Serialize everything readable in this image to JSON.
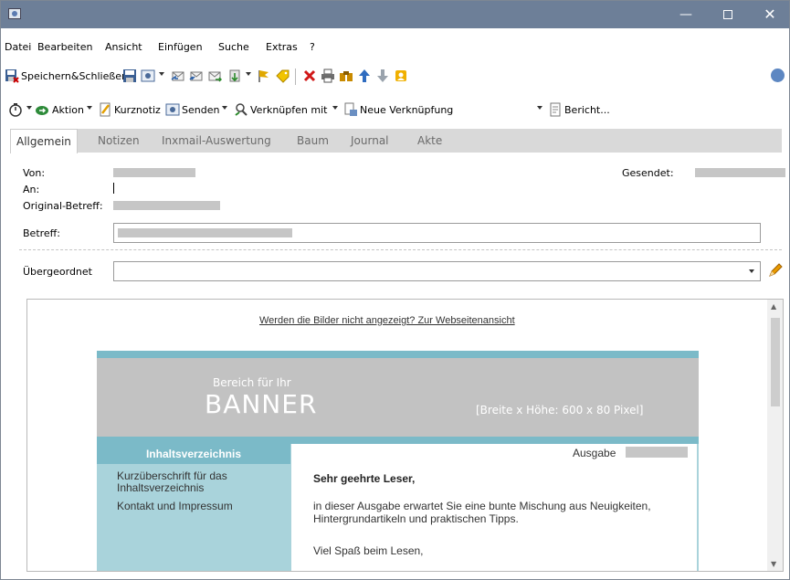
{
  "menu": [
    "Datei",
    "Bearbeiten",
    "Ansicht",
    "Einfügen",
    "Suche",
    "Extras",
    "?"
  ],
  "toolbar1": {
    "save_close_label": "Speichern&Schließen"
  },
  "toolbar2": {
    "aktion": "Aktion",
    "kurznotiz": "Kurznotiz",
    "senden": "Senden",
    "verknuepfen": "Verknüpfen mit",
    "neue_verknuepfung": "Neue Verknüpfung",
    "bericht": "Bericht..."
  },
  "tabs": [
    "Allgemein",
    "Notizen",
    "Inxmail-Auswertung",
    "Baum",
    "Journal",
    "Akte"
  ],
  "form": {
    "von": "Von:",
    "an": "An:",
    "original_betreff": "Original-Betreff:",
    "betreff": "Betreff:",
    "gesendet": "Gesendet:",
    "uebergeordnet": "Übergeordnet"
  },
  "preview": {
    "web_link": "Werden die Bilder nicht angezeigt? Zur Webseitenansicht",
    "banner_small": "Bereich für Ihr",
    "banner_big": "BANNER",
    "banner_dim": "[Breite x Höhe: 600 x 80 Pixel]",
    "toc_head": "Inhaltsverzeichnis",
    "toc_items": [
      "Kurzüberschrift für das Inhaltsverzeichnis",
      "Kontakt und Impressum"
    ],
    "ausgabe": "Ausgabe",
    "greeting": "Sehr geehrte Leser,",
    "body1": "in dieser Ausgabe erwartet Sie eine bunte Mischung aus Neuigkeiten, Hintergrundartikeln und praktischen Tipps.",
    "body2": "Viel Spaß beim Lesen,"
  },
  "colors": {
    "titlebar": "#6d7f98",
    "newsletter_accent": "#7bbac8",
    "newsletter_bg": "#a9d3db",
    "banner": "#c2c2c2"
  }
}
